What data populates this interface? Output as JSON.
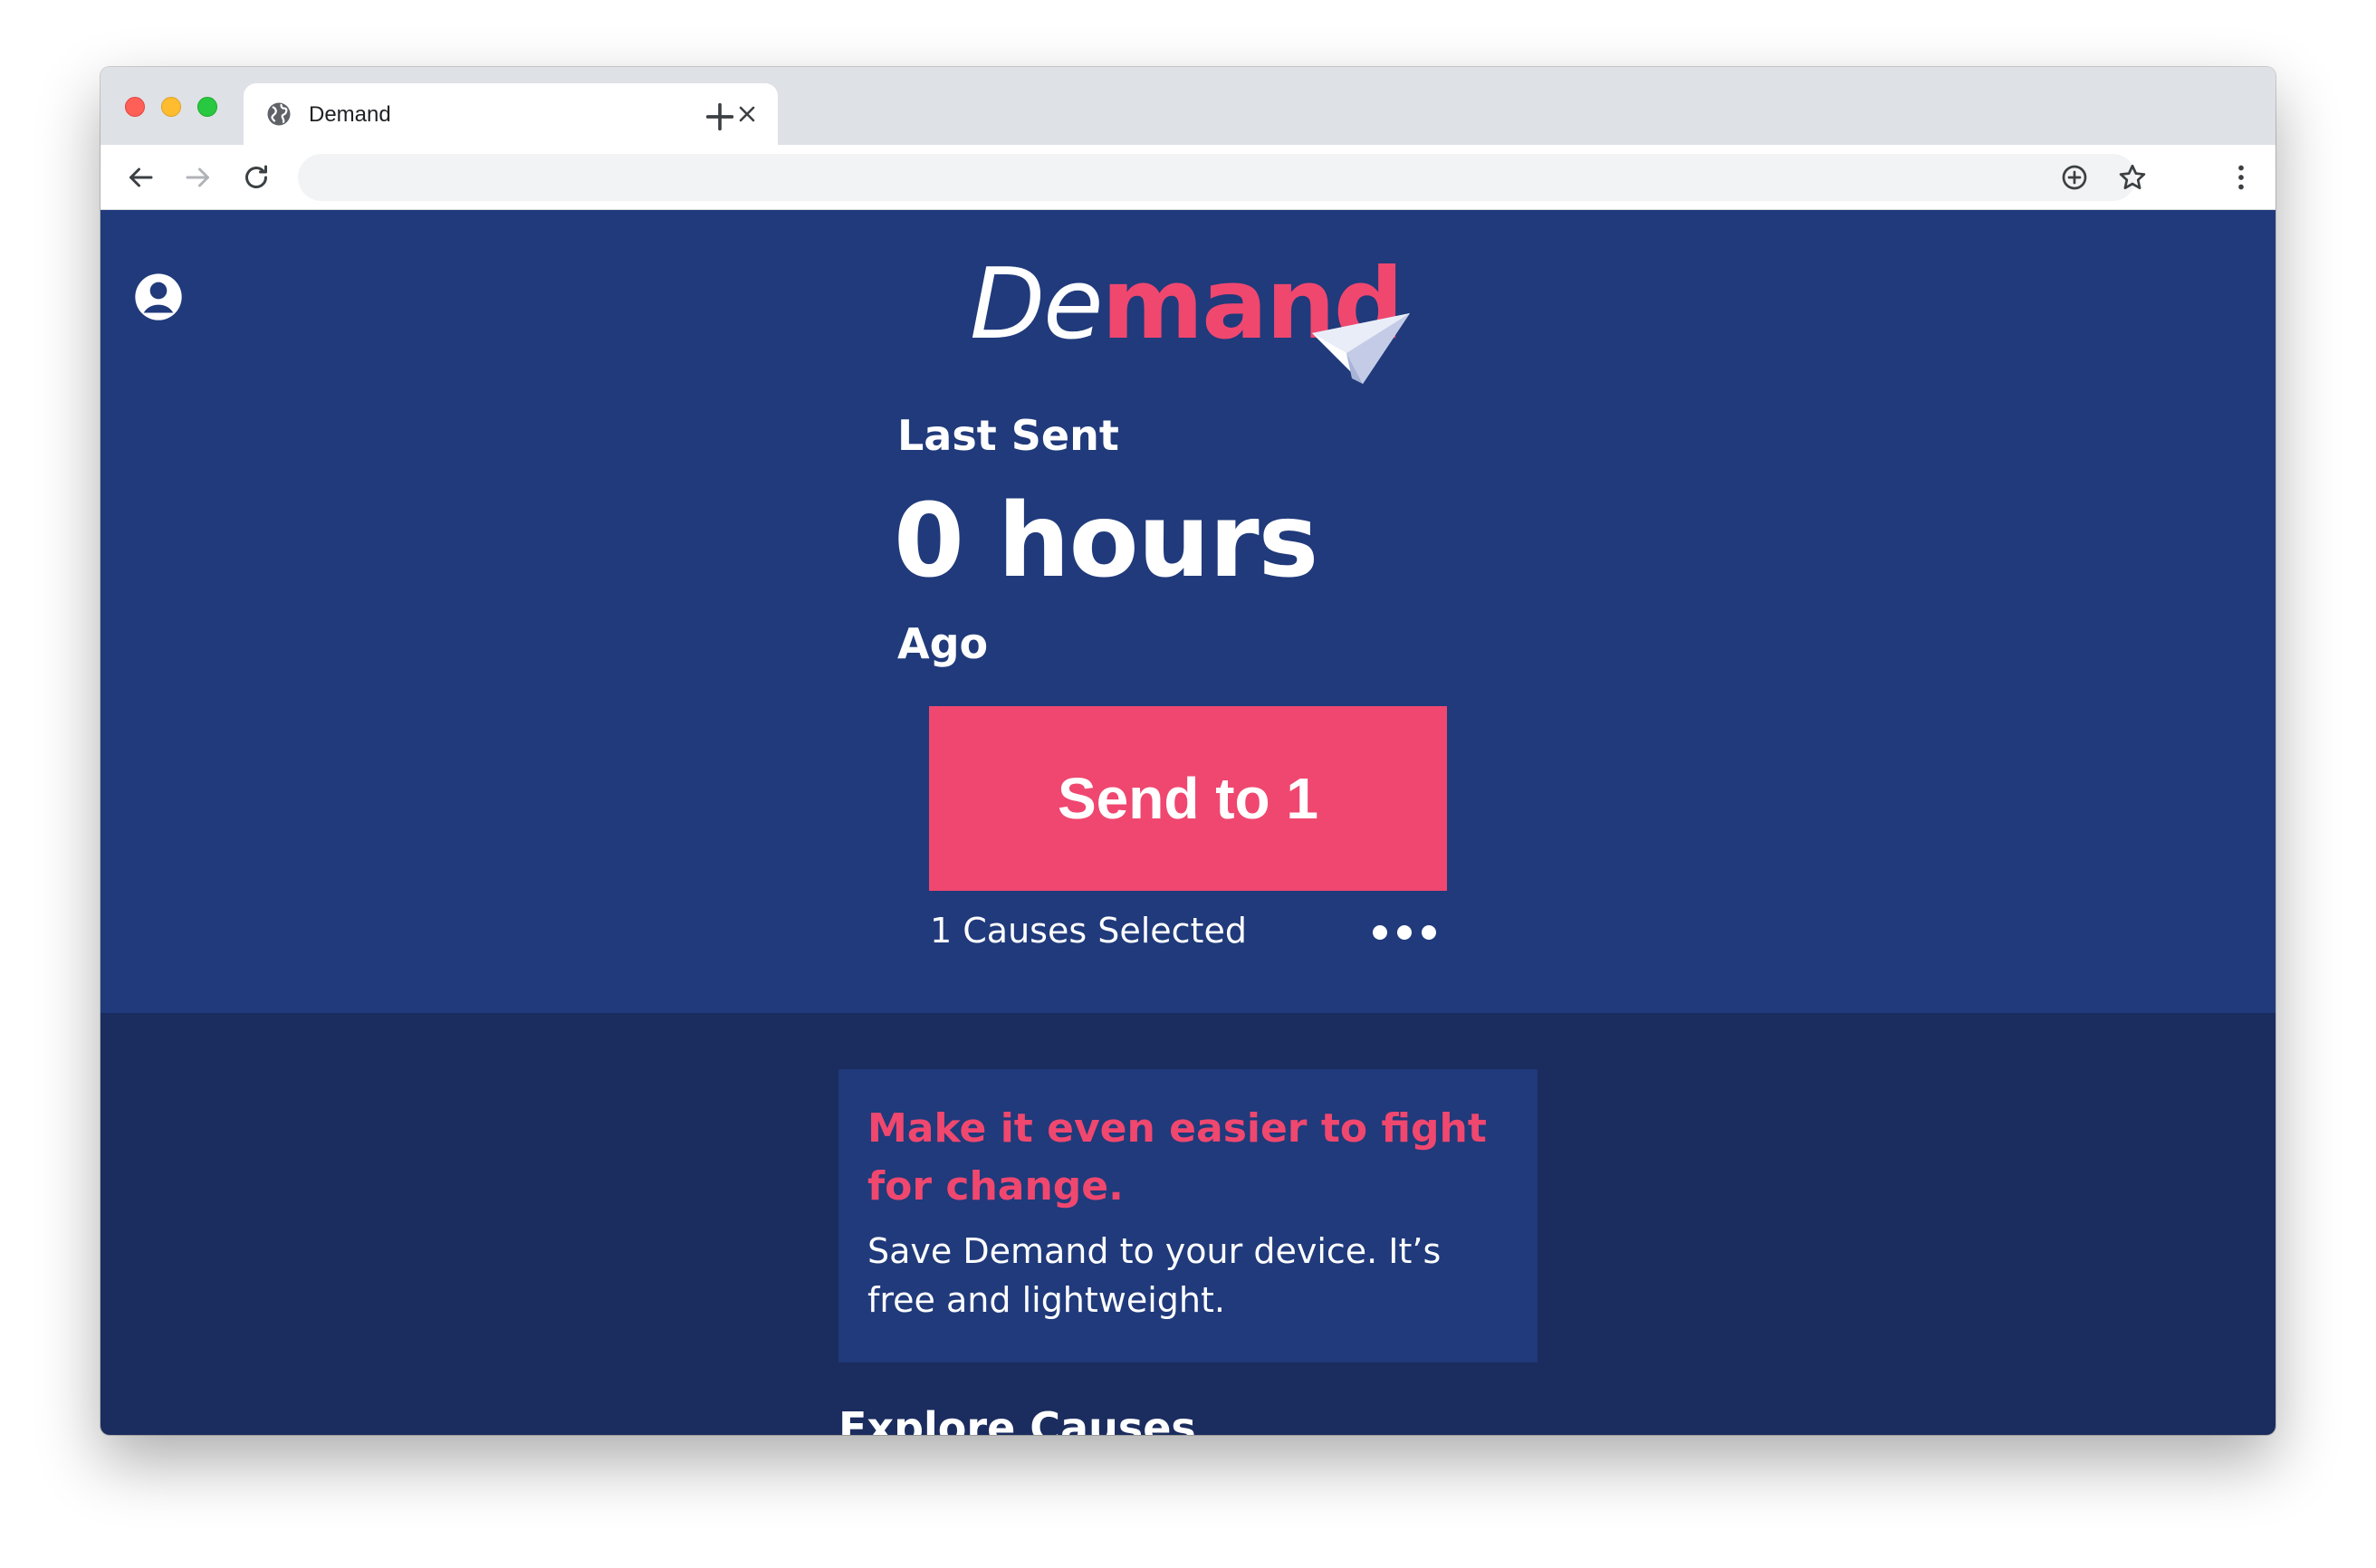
{
  "browser": {
    "tab": {
      "title": "Demand",
      "icon": "globe-icon"
    },
    "toolbar": {
      "address_value": "",
      "icons": [
        "back-arrow-icon",
        "forward-arrow-icon",
        "reload-icon",
        "add-icon",
        "star-icon",
        "kebab-menu-icon"
      ]
    }
  },
  "app": {
    "logo": {
      "part_light": "De",
      "part_bold": "mand"
    },
    "last_sent": {
      "label": "Last Sent",
      "value": "0 hours",
      "suffix": "Ago"
    },
    "send_button_label": "Send to 1",
    "causes_selected": "1 Causes Selected",
    "more_icon": "ellipsis-icon",
    "account_icon": "account-circle-icon",
    "install_banner": {
      "heading": "Make it even easier to fight for change.",
      "body": "Save Demand to your device. It’s free and lightweight."
    },
    "explore_heading": "Explore Causes"
  },
  "colors": {
    "hero_bg": "#203a7b",
    "page_bg": "#1b2c5e",
    "accent": "#ef4770",
    "text": "#ffffff"
  }
}
